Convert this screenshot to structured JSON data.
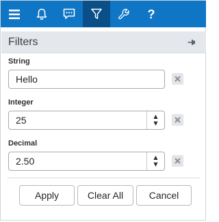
{
  "toolbar": {
    "items": [
      {
        "icon": "menu-icon"
      },
      {
        "icon": "bell-icon"
      },
      {
        "icon": "chat-icon"
      },
      {
        "icon": "filter-icon",
        "active": true
      },
      {
        "icon": "wrench-icon"
      },
      {
        "icon": "help-icon",
        "glyph": "?"
      }
    ],
    "background": "#0f75c5",
    "active_background": "#0a4f87"
  },
  "panel": {
    "title": "Filters",
    "pin_icon": "pin-icon"
  },
  "fields": {
    "string": {
      "label": "String",
      "value": "Hello"
    },
    "integer": {
      "label": "Integer",
      "value": "25"
    },
    "decimal": {
      "label": "Decimal",
      "value": "2.50"
    }
  },
  "buttons": {
    "apply": "Apply",
    "clear_all": "Clear All",
    "cancel": "Cancel"
  }
}
